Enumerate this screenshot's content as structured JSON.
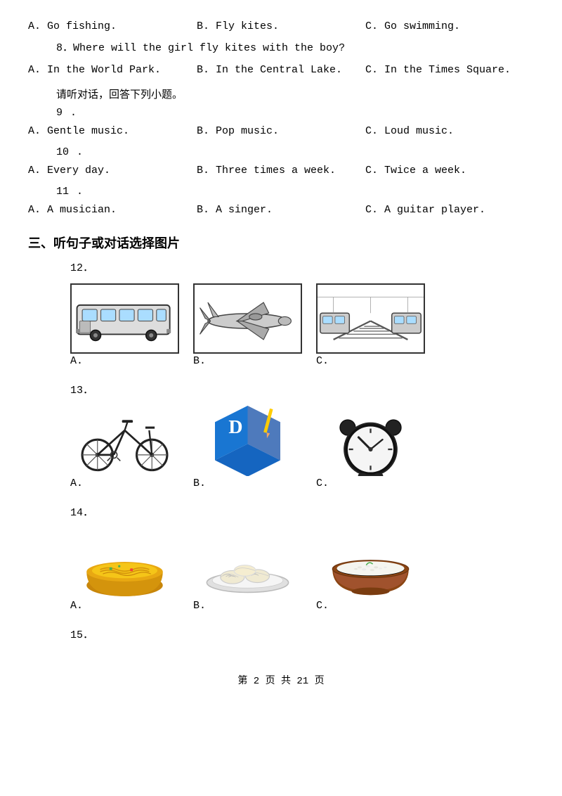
{
  "questions": [
    {
      "id": "q7_options",
      "options": [
        "A. Go fishing.",
        "B. Fly kites.",
        "C. Go swimming."
      ]
    },
    {
      "id": "q8",
      "text": "8．Where will the girl fly kites with the boy?",
      "options": [
        "A. In the World Park.",
        "B. In the Central Lake.",
        "C. In the Times Square."
      ]
    },
    {
      "id": "hint1",
      "text": "请听对话，回答下列小题。"
    },
    {
      "id": "q9",
      "num": "9",
      "options": [
        "A. Gentle music.",
        "B. Pop music.",
        "C. Loud music."
      ]
    },
    {
      "id": "q10",
      "num": "10",
      "options": [
        "A. Every day.",
        "B. Three times a week.",
        "C. Twice a week."
      ]
    },
    {
      "id": "q11",
      "num": "11",
      "options": [
        "A. A musician.",
        "B. A singer.",
        "C. A guitar player."
      ]
    }
  ],
  "section3": {
    "title": "三、听句子或对话选择图片",
    "q12": {
      "num": "12",
      "labels": [
        "A.",
        "B.",
        "C."
      ]
    },
    "q13": {
      "num": "13",
      "labels": [
        "A.",
        "B.",
        "C."
      ]
    },
    "q14": {
      "num": "14",
      "labels": [
        "A.",
        "B.",
        "C."
      ]
    },
    "q15": {
      "num": "15"
    }
  },
  "footer": {
    "text": "第 2 页 共 21 页"
  }
}
